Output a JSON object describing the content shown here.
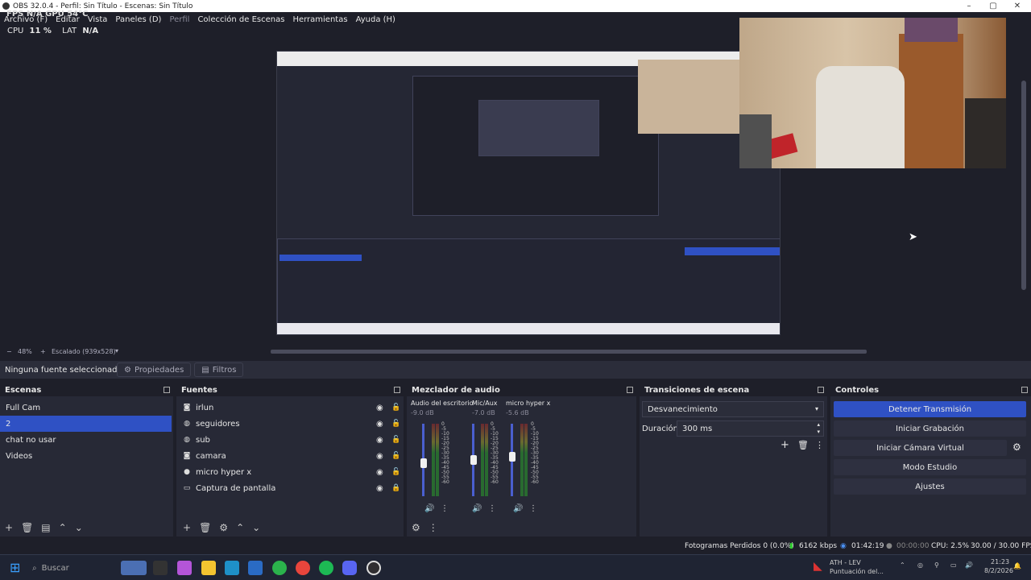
{
  "window": {
    "title": "OBS 32.0.4 - Perfil: Sin Título - Escenas: Sin Título"
  },
  "menu": {
    "items": [
      "Archivo (F)",
      "Editar",
      "Vista",
      "Paneles (D)",
      "Perfil",
      "Colección de Escenas",
      "Herramientas",
      "Ayuda (H)"
    ],
    "overlay": "FPS  N/A    GPU 54°C"
  },
  "perf": {
    "cpu_label": "CPU",
    "cpu_value": "11 %",
    "lat_label": "LAT",
    "lat_value": "N/A"
  },
  "zoom": {
    "level": "48%",
    "scaling": "Escalado (939x528)"
  },
  "context": {
    "no_source": "Ninguna fuente seleccionad",
    "properties": "Propiedades",
    "filters": "Filtros"
  },
  "scenes": {
    "title": "Escenas",
    "items": [
      "Full Cam",
      "2",
      "chat no usar",
      "Videos"
    ],
    "selected_index": 1
  },
  "sources": {
    "title": "Fuentes",
    "items": [
      {
        "name": "irlun",
        "icon": "camera-icon"
      },
      {
        "name": "seguidores",
        "icon": "globe-icon"
      },
      {
        "name": "sub",
        "icon": "globe-icon"
      },
      {
        "name": "camara",
        "icon": "camera-icon"
      },
      {
        "name": "micro hyper x",
        "icon": "mic-icon"
      },
      {
        "name": "Captura de pantalla",
        "icon": "monitor-icon"
      }
    ]
  },
  "mixer": {
    "title": "Mezclador de audio",
    "channels": [
      {
        "name": "Audio del escritorio",
        "db": "-9.0 dB",
        "level": 0.45
      },
      {
        "name": "Mic/Aux",
        "db": "-7.0 dB",
        "level": 0.5
      },
      {
        "name": "micro hyper x",
        "db": "-5.6 dB",
        "level": 0.55
      }
    ],
    "scale": [
      "0",
      "-5",
      "-10",
      "-15",
      "-20",
      "-25",
      "-30",
      "-35",
      "-40",
      "-45",
      "-50",
      "-55",
      "-60"
    ]
  },
  "transitions": {
    "title": "Transiciones de escena",
    "selected": "Desvanecimiento",
    "duration_label": "Duración",
    "duration_value": "300 ms"
  },
  "controls": {
    "title": "Controles",
    "stop_stream": "Detener Transmisión",
    "start_recording": "Iniciar Grabación",
    "virtual_cam": "Iniciar Cámara Virtual",
    "studio_mode": "Modo Estudio",
    "settings": "Ajustes"
  },
  "status": {
    "dropped": "Fotogramas Perdidos 0 (0.0%)",
    "bitrate": "6162 kbps",
    "stream_time": "01:42:19",
    "rec_time": "00:00:00",
    "cpu": "CPU: 2.5%",
    "fps": "30.00 / 30.00 FPS"
  },
  "taskbar": {
    "search_placeholder": "Buscar",
    "notif_title": "ATH - LEV",
    "notif_sub": "Puntuación del...",
    "time": "21:23",
    "date": "8/2/2026"
  }
}
